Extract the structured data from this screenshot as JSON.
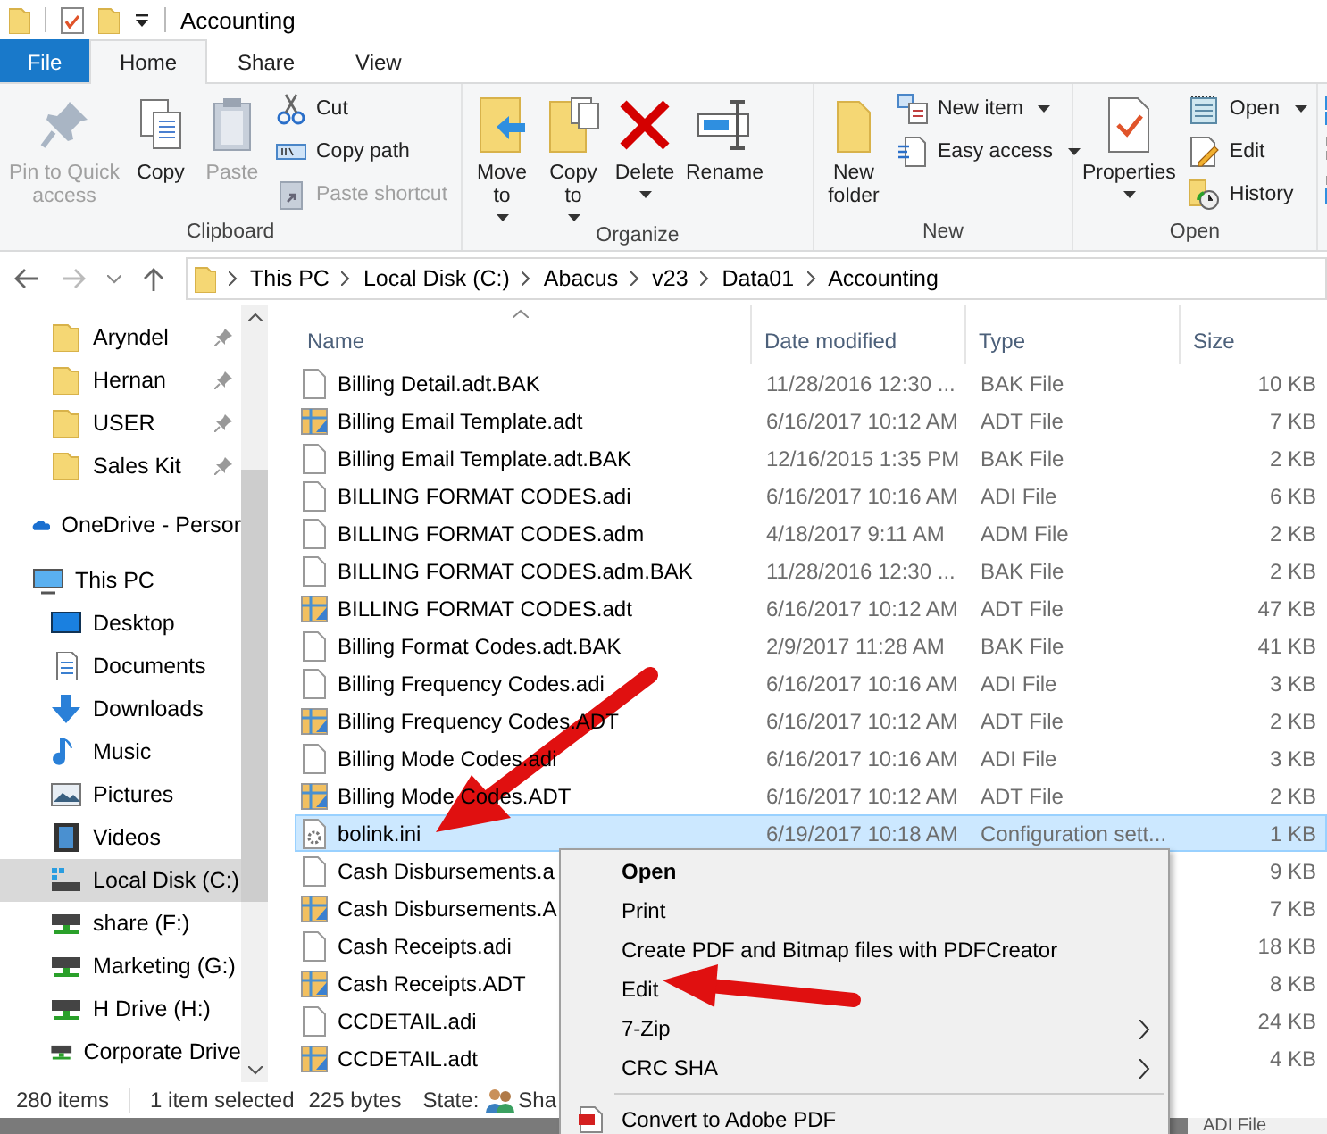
{
  "title_bar": {
    "title": "Accounting"
  },
  "ribbon_tabs": [
    {
      "label": "File",
      "kind": "file",
      "selected": false
    },
    {
      "label": "Home",
      "kind": "tab",
      "selected": true
    },
    {
      "label": "Share",
      "kind": "tab",
      "selected": false
    },
    {
      "label": "View",
      "kind": "tab",
      "selected": false
    }
  ],
  "ribbon_groups": [
    {
      "label": "Clipboard",
      "large": [
        {
          "lines": [
            "Pin to Quick",
            "access"
          ],
          "disabled": true,
          "dropdown": false
        },
        {
          "lines": [
            "Copy"
          ],
          "disabled": false,
          "dropdown": false
        },
        {
          "lines": [
            "Paste"
          ],
          "disabled": true,
          "dropdown": false
        }
      ],
      "small": [
        {
          "label": "Cut",
          "disabled": false,
          "dropdown": false
        },
        {
          "label": "Copy path",
          "disabled": false,
          "dropdown": false
        },
        {
          "label": "Paste shortcut",
          "disabled": true,
          "dropdown": false
        }
      ]
    },
    {
      "label": "Organize",
      "large": [
        {
          "lines": [
            "Move",
            "to"
          ],
          "disabled": false,
          "dropdown": true
        },
        {
          "lines": [
            "Copy",
            "to"
          ],
          "disabled": false,
          "dropdown": true
        },
        {
          "lines": [
            "Delete"
          ],
          "disabled": false,
          "dropdown": true
        },
        {
          "lines": [
            "Rename"
          ],
          "disabled": false,
          "dropdown": false
        }
      ]
    },
    {
      "label": "New",
      "large": [
        {
          "lines": [
            "New",
            "folder"
          ],
          "disabled": false,
          "dropdown": false
        }
      ],
      "small": [
        {
          "label": "New item",
          "disabled": false,
          "dropdown": true
        },
        {
          "label": "Easy access",
          "disabled": false,
          "dropdown": true
        }
      ]
    },
    {
      "label": "Open",
      "large": [
        {
          "lines": [
            "Properties"
          ],
          "disabled": false,
          "dropdown": true
        }
      ],
      "small": [
        {
          "label": "Open",
          "disabled": false,
          "dropdown": true
        },
        {
          "label": "Edit",
          "disabled": false,
          "dropdown": false
        },
        {
          "label": "History",
          "disabled": false,
          "dropdown": false
        }
      ]
    }
  ],
  "address_bar": {
    "crumbs": [
      "This PC",
      "Local Disk (C:)",
      "Abacus",
      "v23",
      "Data01",
      "Accounting"
    ]
  },
  "nav": [
    {
      "label": "Aryndel",
      "kind": "folder",
      "pinned": true,
      "selected": false
    },
    {
      "label": "Hernan",
      "kind": "folder",
      "pinned": true,
      "selected": false
    },
    {
      "label": "USER",
      "kind": "folder",
      "pinned": true,
      "selected": false
    },
    {
      "label": "Sales Kit",
      "kind": "folder",
      "pinned": true,
      "selected": false
    },
    {
      "label": "OneDrive - Persor",
      "kind": "cloud",
      "pinned": false,
      "selected": false
    },
    {
      "label": "This PC",
      "kind": "pc",
      "pinned": false,
      "selected": false,
      "children": [
        {
          "label": "Desktop",
          "kind": "desktop",
          "pinned": false,
          "selected": false
        },
        {
          "label": "Documents",
          "kind": "documents",
          "pinned": false,
          "selected": false
        },
        {
          "label": "Downloads",
          "kind": "downloads",
          "pinned": false,
          "selected": false
        },
        {
          "label": "Music",
          "kind": "music",
          "pinned": false,
          "selected": false
        },
        {
          "label": "Pictures",
          "kind": "pictures",
          "pinned": false,
          "selected": false
        },
        {
          "label": "Videos",
          "kind": "videos",
          "pinned": false,
          "selected": false
        },
        {
          "label": "Local Disk (C:)",
          "kind": "disk",
          "pinned": false,
          "selected": true
        },
        {
          "label": "share (F:)",
          "kind": "netdrive",
          "pinned": false,
          "selected": false
        },
        {
          "label": "Marketing (G:)",
          "kind": "netdrive",
          "pinned": false,
          "selected": false
        },
        {
          "label": "H Drive (H:)",
          "kind": "netdrive",
          "pinned": false,
          "selected": false
        },
        {
          "label": "Corporate Drive",
          "kind": "netdrive",
          "pinned": false,
          "selected": false
        }
      ]
    }
  ],
  "table": {
    "columns": [
      {
        "label": "Name",
        "sorted": true
      },
      {
        "label": "Date modified",
        "sorted": false
      },
      {
        "label": "Type",
        "sorted": false
      },
      {
        "label": "Size",
        "sorted": false
      }
    ],
    "rows": [
      {
        "name": "Billing Detail.adt.BAK",
        "date": "11/28/2016 12:30 ...",
        "type": "BAK File",
        "size": "10 KB",
        "kind": "plain",
        "selected": false
      },
      {
        "name": "Billing Email Template.adt",
        "date": "6/16/2017 10:12 AM",
        "type": "ADT File",
        "size": "7 KB",
        "kind": "table",
        "selected": false
      },
      {
        "name": "Billing Email Template.adt.BAK",
        "date": "12/16/2015 1:35 PM",
        "type": "BAK File",
        "size": "2 KB",
        "kind": "plain",
        "selected": false
      },
      {
        "name": "BILLING FORMAT CODES.adi",
        "date": "6/16/2017 10:16 AM",
        "type": "ADI File",
        "size": "6 KB",
        "kind": "plain",
        "selected": false
      },
      {
        "name": "BILLING FORMAT CODES.adm",
        "date": "4/18/2017 9:11 AM",
        "type": "ADM File",
        "size": "2 KB",
        "kind": "plain",
        "selected": false
      },
      {
        "name": "BILLING FORMAT CODES.adm.BAK",
        "date": "11/28/2016 12:30 ...",
        "type": "BAK File",
        "size": "2 KB",
        "kind": "plain",
        "selected": false
      },
      {
        "name": "BILLING FORMAT CODES.adt",
        "date": "6/16/2017 10:12 AM",
        "type": "ADT File",
        "size": "47 KB",
        "kind": "table",
        "selected": false
      },
      {
        "name": "Billing Format Codes.adt.BAK",
        "date": "2/9/2017 11:28 AM",
        "type": "BAK File",
        "size": "41 KB",
        "kind": "plain",
        "selected": false
      },
      {
        "name": "Billing Frequency Codes.adi",
        "date": "6/16/2017 10:16 AM",
        "type": "ADI File",
        "size": "3 KB",
        "kind": "plain",
        "selected": false
      },
      {
        "name": "Billing Frequency Codes.ADT",
        "date": "6/16/2017 10:12 AM",
        "type": "ADT File",
        "size": "2 KB",
        "kind": "table",
        "selected": false
      },
      {
        "name": "Billing Mode Codes.adi",
        "date": "6/16/2017 10:16 AM",
        "type": "ADI File",
        "size": "3 KB",
        "kind": "plain",
        "selected": false
      },
      {
        "name": "Billing Mode Codes.ADT",
        "date": "6/16/2017 10:12 AM",
        "type": "ADT File",
        "size": "2 KB",
        "kind": "table",
        "selected": false
      },
      {
        "name": "bolink.ini",
        "date": "6/19/2017 10:18 AM",
        "type": "Configuration sett...",
        "size": "1 KB",
        "kind": "config",
        "selected": true
      },
      {
        "name": "Cash Disbursements.a",
        "size": "9 KB",
        "kind": "plain",
        "selected": false
      },
      {
        "name": "Cash Disbursements.A",
        "size": "7 KB",
        "kind": "table",
        "selected": false
      },
      {
        "name": "Cash Receipts.adi",
        "size": "18 KB",
        "kind": "plain",
        "selected": false
      },
      {
        "name": "Cash Receipts.ADT",
        "size": "8 KB",
        "kind": "table",
        "selected": false
      },
      {
        "name": "CCDETAIL.adi",
        "size": "24 KB",
        "kind": "plain",
        "selected": false
      },
      {
        "name": "CCDETAIL.adt",
        "size": "4 KB",
        "kind": "table",
        "selected": false
      }
    ]
  },
  "status_bar": {
    "count": "280 items",
    "selection": "1 item selected",
    "bytes": "225 bytes",
    "state_label": "State:",
    "state_value": "Sha"
  },
  "context_menu": {
    "items": [
      {
        "label": "Open",
        "kind": "default",
        "submenu": false
      },
      {
        "label": "Print",
        "kind": "item",
        "submenu": false
      },
      {
        "label": "Create PDF and Bitmap files with PDFCreator",
        "kind": "item",
        "submenu": false
      },
      {
        "label": "Edit",
        "kind": "item",
        "submenu": false
      },
      {
        "label": "7-Zip",
        "kind": "item",
        "submenu": true
      },
      {
        "label": "CRC SHA",
        "kind": "item",
        "submenu": true
      },
      {
        "kind": "separator"
      },
      {
        "label": "Convert to Adobe PDF",
        "kind": "pdf",
        "submenu": false
      }
    ]
  },
  "taskbar_strip": {
    "text": "ADI File"
  }
}
